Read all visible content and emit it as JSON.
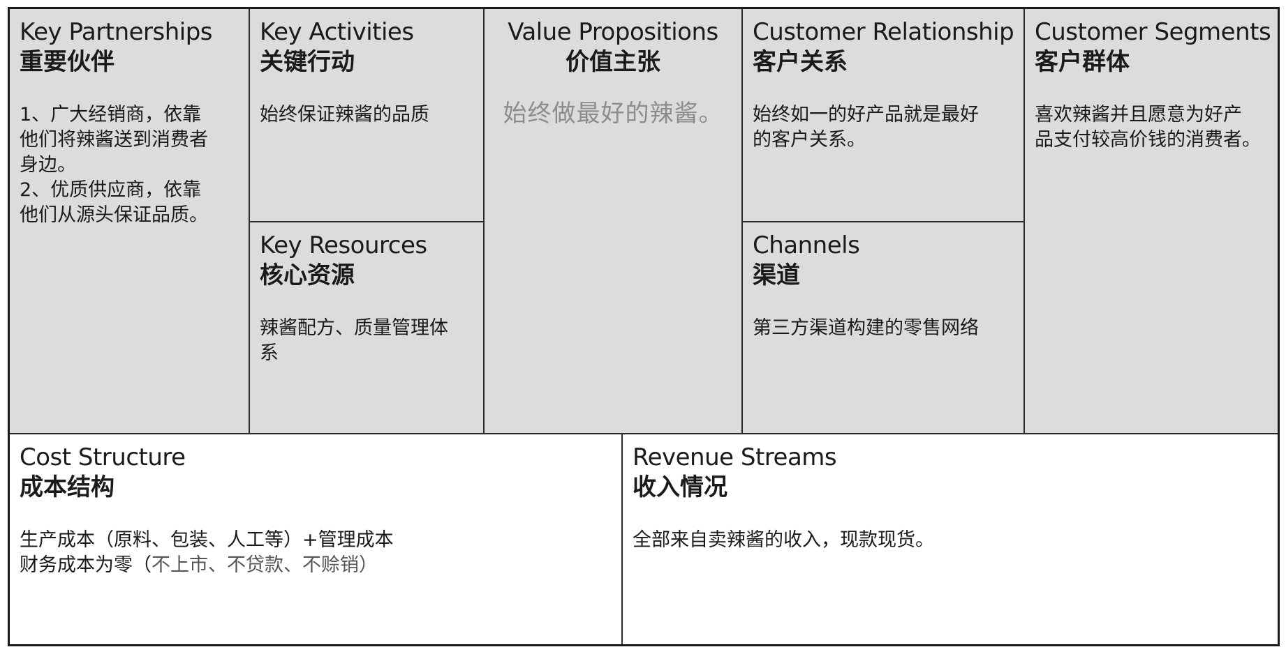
{
  "canvas": {
    "key_partnerships": {
      "title_en": "Key Partnerships",
      "title_zh": "重要伙伴",
      "lines": [
        "1、广大经销商，依靠",
        "他们将辣酱送到消费者",
        "身边。",
        "2、优质供应商，依靠",
        "他们从源头保证品质。"
      ]
    },
    "key_activities": {
      "title_en": "Key Activities",
      "title_zh": "关键行动",
      "lines": [
        "始终保证辣酱的品质"
      ]
    },
    "key_resources": {
      "title_en": "Key Resources",
      "title_zh": "核心资源",
      "lines": [
        "辣酱配方、质量管理体",
        "系"
      ]
    },
    "value_propositions": {
      "title_en": "Value Propositions",
      "title_zh": "价值主张",
      "lines": [
        "始终做最好的辣酱。"
      ]
    },
    "customer_relationship": {
      "title_en": "Customer Relationship",
      "title_zh": "客户关系",
      "lines": [
        "始终如一的好产品就是最好",
        "的客户关系。"
      ]
    },
    "channels": {
      "title_en": "Channels",
      "title_zh": "渠道",
      "lines": [
        "第三方渠道构建的零售网络"
      ]
    },
    "customer_segments": {
      "title_en": "Customer Segments",
      "title_zh": "客户群体",
      "lines": [
        "喜欢辣酱并且愿意为好产",
        "品支付较高价钱的消费者。"
      ]
    },
    "cost_structure": {
      "title_en": "Cost Structure",
      "title_zh": "成本结构",
      "line1": "生产成本（原料、包装、人工等）+管理成本",
      "line2_a": "财务成本为零（",
      "line2_b": "不上市、不贷款、不赊销）"
    },
    "revenue_streams": {
      "title_en": "Revenue Streams",
      "title_zh": "收入情况",
      "lines": [
        "全部来自卖辣酱的收入，现款现货。"
      ]
    }
  }
}
